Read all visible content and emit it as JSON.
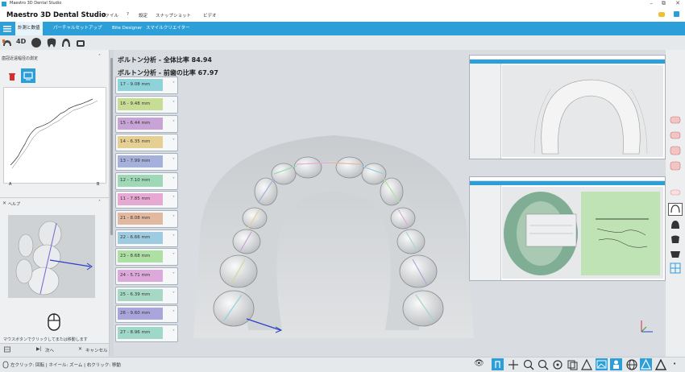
{
  "window": {
    "title": "Maestro 3D Dental Studio"
  },
  "menubar": {
    "brand": "Maestro 3D Dental Studio",
    "items": [
      "ファイル",
      "?",
      "設定",
      "スナップショット",
      "ビデオ"
    ]
  },
  "tabs": [
    "計測と数値",
    "パーチャルセットアップ",
    "Bite Designer",
    "スマイルクリエイター"
  ],
  "toolbar": {
    "mode_label": "4D"
  },
  "left_panel": {
    "title": "歯冠近遠幅径の測定",
    "chart_label_a": "A",
    "chart_label_b": "B",
    "help_title": "ヘルプ",
    "help_text": "マウスボタンでクリックしてまたは移動します"
  },
  "footer": {
    "next_label": "次へ",
    "cancel_label": "キャンセル",
    "status": "左クリック: 回転 | ホイール: ズーム | 右クリック: 移動"
  },
  "analysis": {
    "overall": "ボルトン分析 - 全体比率 84.94",
    "anterior": "ボルトン分析 - 前歯の比率 67.97"
  },
  "teeth": [
    {
      "label": "17 - 9.08 mm",
      "color": "#8fd3da"
    },
    {
      "label": "16 - 9.48 mm",
      "color": "#c7dc95"
    },
    {
      "label": "15 - 6.44 mm",
      "color": "#c7a3d6"
    },
    {
      "label": "14 - 6.35 mm",
      "color": "#e6cf93"
    },
    {
      "label": "13 - 7.99 mm",
      "color": "#a5b1da"
    },
    {
      "label": "12 - 7.10 mm",
      "color": "#9fd8b6"
    },
    {
      "label": "11 - 7.85 mm",
      "color": "#e6a9d4"
    },
    {
      "label": "21 - 8.08 mm",
      "color": "#e3b8a0"
    },
    {
      "label": "22 - 6.66 mm",
      "color": "#9fcbe0"
    },
    {
      "label": "23 - 8.68 mm",
      "color": "#aee0a3"
    },
    {
      "label": "24 - 5.71 mm",
      "color": "#dca9da"
    },
    {
      "label": "25 - 6.39 mm",
      "color": "#a7d8c6"
    },
    {
      "label": "26 - 9.60 mm",
      "color": "#aaa6dc"
    },
    {
      "label": "27 - 8.96 mm",
      "color": "#9fd8c8"
    }
  ]
}
